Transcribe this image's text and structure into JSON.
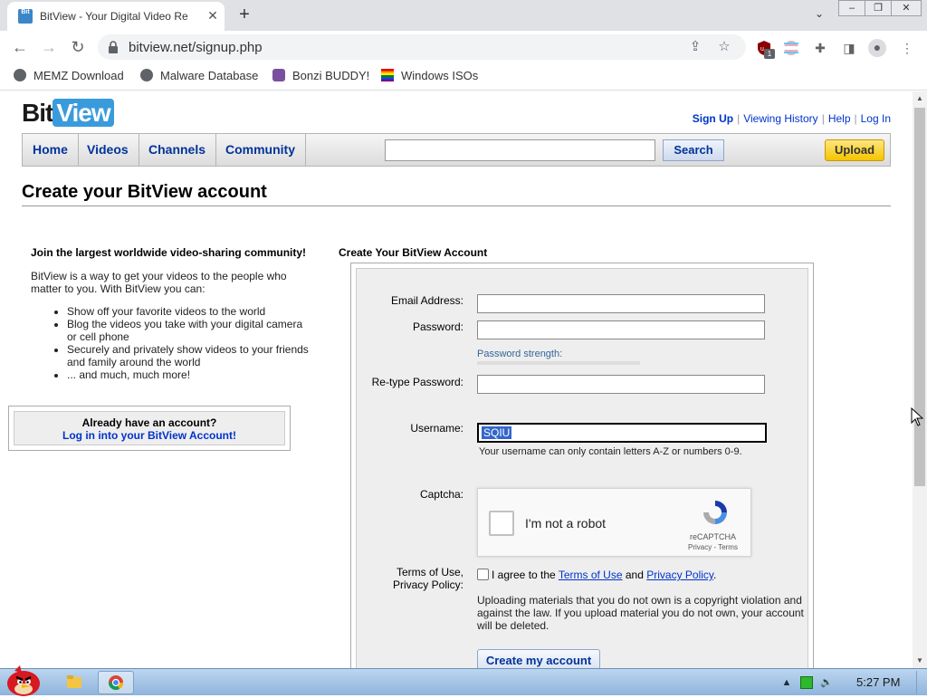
{
  "browser": {
    "tab_title": "BitView - Your Digital Video Re",
    "favicon_text": "Bit",
    "url": "bitview.net/signup.php",
    "bookmarks": [
      "MEMZ Download",
      "Malware Database",
      "Bonzi BUDDY!",
      "Windows ISOs"
    ],
    "extension_badge": "1"
  },
  "site": {
    "logo_bit": "Bit",
    "logo_view": "View",
    "top_links": [
      "Sign Up",
      "Viewing History",
      "Help",
      "Log In"
    ],
    "nav_tabs": [
      "Home",
      "Videos",
      "Channels",
      "Community"
    ],
    "search_button": "Search",
    "upload_button": "Upload"
  },
  "page": {
    "title": "Create your BitView account",
    "intro_heading": "Join the largest worldwide video-sharing community!",
    "intro_text": "BitView is a way to get your videos to the people who matter to you. With BitView you can:",
    "intro_items": [
      "Show off your favorite videos to the world",
      "Blog the videos you take with your digital camera or cell phone",
      "Securely and privately show videos to your friends and family around the world",
      "... and much, much more!"
    ],
    "login_question": "Already have an account?",
    "login_link": "Log in into your BitView Account!"
  },
  "form": {
    "heading": "Create Your BitView Account",
    "email_label": "Email Address:",
    "email_value": "",
    "password_label": "Password:",
    "password_value": "",
    "password_strength": "Password strength:",
    "retype_label": "Re-type Password:",
    "retype_value": "",
    "username_label": "Username:",
    "username_value": "SQIU",
    "username_hint": "Your username can only contain letters A-Z or numbers 0-9.",
    "captcha_label": "Captcha:",
    "captcha_text": "I'm not a robot",
    "captcha_brand": "reCAPTCHA",
    "captcha_privacy": "Privacy - Terms",
    "terms_label_1": "Terms of Use,",
    "terms_label_2": "Privacy Policy:",
    "terms_prefix": "I agree to the",
    "terms_link": "Terms of Use",
    "terms_and": "and",
    "privacy_link": "Privacy Policy",
    "terms_suffix": ".",
    "legal_text": "Uploading materials that you do not own is a copyright violation and against the law. If you upload material you do not own, your account will be deleted.",
    "submit_label": "Create my account"
  },
  "taskbar": {
    "clock": "5:27 PM"
  }
}
